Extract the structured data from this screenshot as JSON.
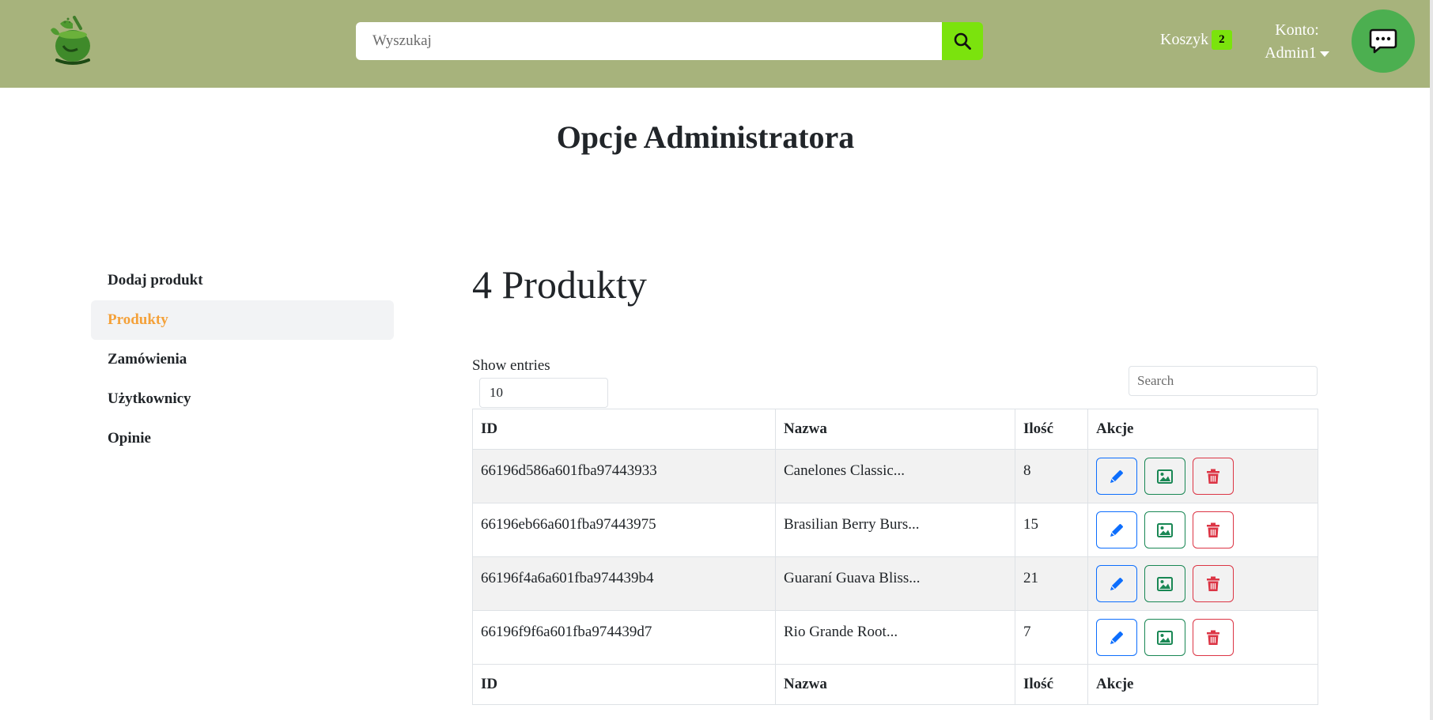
{
  "header": {
    "search_placeholder": "Wyszukaj",
    "cart_label": "Koszyk",
    "cart_count": "2",
    "account_label": "Konto:",
    "account_user": "Admin1"
  },
  "page_title": "Opcje Administratora",
  "sidebar": {
    "items": [
      {
        "label": "Dodaj produkt",
        "active": false
      },
      {
        "label": "Produkty",
        "active": true
      },
      {
        "label": "Zamówienia",
        "active": false
      },
      {
        "label": "Użytkownicy",
        "active": false
      },
      {
        "label": "Opinie",
        "active": false
      }
    ]
  },
  "main": {
    "heading": "4 Produkty",
    "show_entries_label": "Show entries",
    "entries_value": "10",
    "search_placeholder": "Search",
    "columns": [
      "ID",
      "Nazwa",
      "Ilość",
      "Akcje"
    ],
    "rows": [
      {
        "id": "66196d586a601fba97443933",
        "name": "Canelones Classic...",
        "qty": "8"
      },
      {
        "id": "66196eb66a601fba97443975",
        "name": "Brasilian Berry Burs...",
        "qty": "15"
      },
      {
        "id": "66196f4a6a601fba974439b4",
        "name": "Guaraní Guava Bliss...",
        "qty": "21"
      },
      {
        "id": "66196f9f6a601fba974439d7",
        "name": "Rio Grande Root...",
        "qty": "7"
      }
    ]
  },
  "colors": {
    "header_bg": "#a7b37c",
    "accent_green": "#7be30d",
    "chat_green": "#4caf50",
    "active_orange": "#f4a13a",
    "edit_blue": "#0d6efd",
    "image_green": "#198754",
    "delete_red": "#dc3545"
  },
  "icons": [
    "logo-icon",
    "search-icon",
    "caret-down-icon",
    "chat-icon",
    "pencil-icon",
    "image-icon",
    "trash-icon"
  ]
}
